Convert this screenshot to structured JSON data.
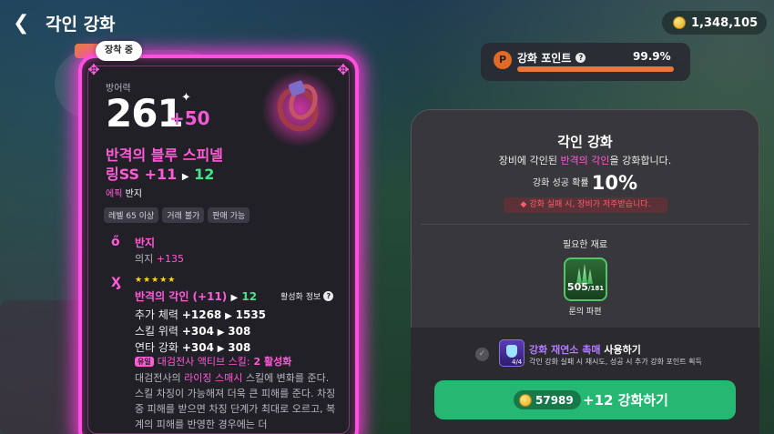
{
  "header": {
    "back_icon": "back-arrow-icon",
    "title": "각인 강화",
    "coins": "1,348,105"
  },
  "item": {
    "equip_tag": "장착 중",
    "stat_label": "방어력",
    "stat_value": "261",
    "stat_bonus": "+50",
    "name_line1": "반격의 블루 스피넬",
    "name_line2_prefix": "링SS +11",
    "name_line2_next": "12",
    "grade": "에픽",
    "type": "반지",
    "chips": [
      "레벨 65 이상",
      "거래 불가",
      "판매 가능"
    ],
    "base_title": "반지",
    "base_stat_label": "의지",
    "base_stat_value": "+135",
    "stars": "★★★★★",
    "engrave_title": "반격의 각인 (+11)",
    "engrave_next": "12",
    "activate_info": "활성화 정보",
    "rows": [
      {
        "label": "추가 체력",
        "from": "+1268",
        "to": "1535"
      },
      {
        "label": "스킬 위력",
        "from": "+304",
        "to": "308"
      },
      {
        "label": "연타 강화",
        "from": "+304",
        "to": "308"
      }
    ],
    "set_badge": "유일",
    "set_text_a": "대검전사 액티브 스킬:",
    "set_text_b": "2 활성화",
    "desc_a": "대검전사의 ",
    "desc_hl": "라이징 스매시",
    "desc_b": " 스킬에 변화를 준다.",
    "desc_c": "스킬 차징이 가능해져 더욱 큰 피해를 준다. 차징 중 피해를 받으면 차징 단계가 최대로 오르고, 복계의 피해를 반영한 경우에는 더"
  },
  "points": {
    "label": "강화 포인트",
    "value": "99.9%",
    "fill": 0.999
  },
  "panel": {
    "title": "각인 강화",
    "sub_a": "장비에 각인된 ",
    "sub_hl": "반격의 각인",
    "sub_b": "을 강화합니다.",
    "rate_label": "강화 성공 확률",
    "rate_value": "10%",
    "warning": "강화 실패 시, 장비가 저주받습니다.",
    "mat_label": "필요한 재료",
    "mat_count": "505",
    "mat_total": "/181",
    "mat_name": "룬의 파편",
    "catalyst_hl": "강화 재연소 촉매",
    "catalyst_rest": " 사용하기",
    "catalyst_desc": "각인 강화 실패 시 재시도, 성공 시 추가 강화 포인트 획득",
    "catalyst_count": "4/4",
    "price": "57989",
    "button": "+12 강화하기"
  },
  "colors": {
    "accent_pink": "#ff5ad8",
    "green": "#24b872",
    "orange": "#e8763b"
  }
}
